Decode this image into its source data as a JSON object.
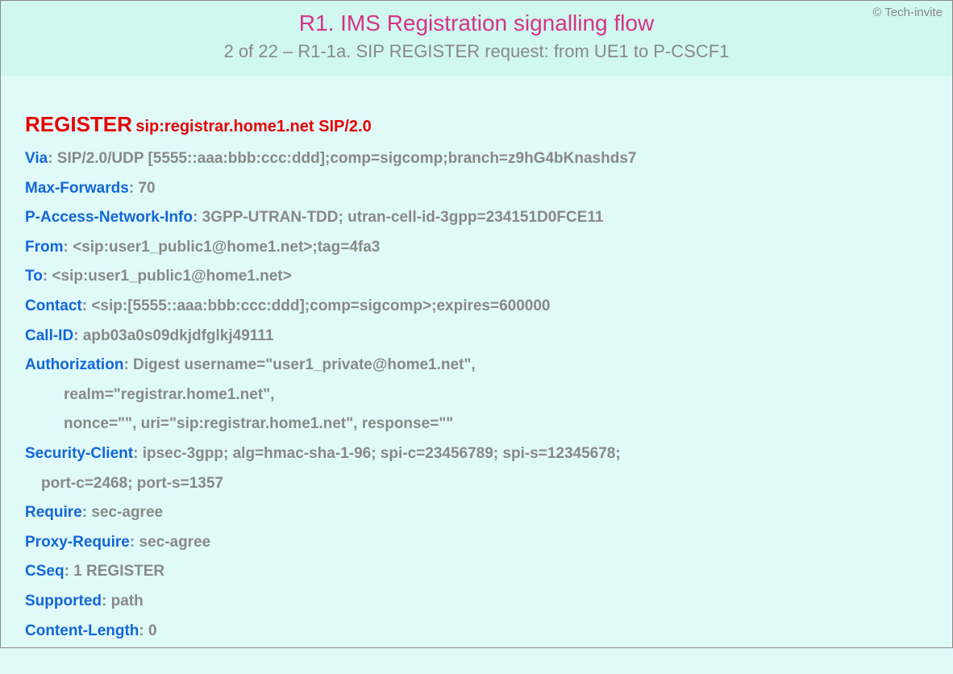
{
  "copyright": "© Tech-invite",
  "title": "R1. IMS Registration signalling flow",
  "subtitle": "2 of 22 – R1-1a. SIP REGISTER request: from UE1 to P-CSCF1",
  "request": {
    "method": "REGISTER",
    "uri": "sip:registrar.home1.net SIP/2.0"
  },
  "headers": [
    {
      "name": "Via",
      "value": ": SIP/2.0/UDP [5555::aaa:bbb:ccc:ddd];comp=sigcomp;branch=z9hG4bKnashds7"
    },
    {
      "name": "Max-Forwards",
      "value": ": 70"
    },
    {
      "name": "P-Access-Network-Info",
      "value": ": 3GPP-UTRAN-TDD; utran-cell-id-3gpp=234151D0FCE11"
    },
    {
      "name": "From",
      "value": ": <sip:user1_public1@home1.net>;tag=4fa3"
    },
    {
      "name": "To",
      "value": ": <sip:user1_public1@home1.net>"
    },
    {
      "name": "Contact",
      "value": ": <sip:[5555::aaa:bbb:ccc:ddd];comp=sigcomp>;expires=600000"
    },
    {
      "name": "Call-ID",
      "value": ": apb03a0s09dkjdfglkj49111"
    },
    {
      "name": "Authorization",
      "value": ": Digest username=\"user1_private@home1.net\","
    }
  ],
  "auth_cont1": "realm=\"registrar.home1.net\",",
  "auth_cont2": "nonce=\"\", uri=\"sip:registrar.home1.net\", response=\"\"",
  "headers2": [
    {
      "name": "Security-Client",
      "value": ": ipsec-3gpp; alg=hmac-sha-1-96; spi-c=23456789; spi-s=12345678;"
    }
  ],
  "sec_cont": "port-c=2468; port-s=1357",
  "headers3": [
    {
      "name": "Require",
      "value": ": sec-agree"
    },
    {
      "name": "Proxy-Require",
      "value": ": sec-agree"
    },
    {
      "name": "CSeq",
      "value": ": 1 REGISTER"
    },
    {
      "name": "Supported",
      "value": ": path"
    },
    {
      "name": "Content-Length",
      "value": ": 0"
    }
  ]
}
